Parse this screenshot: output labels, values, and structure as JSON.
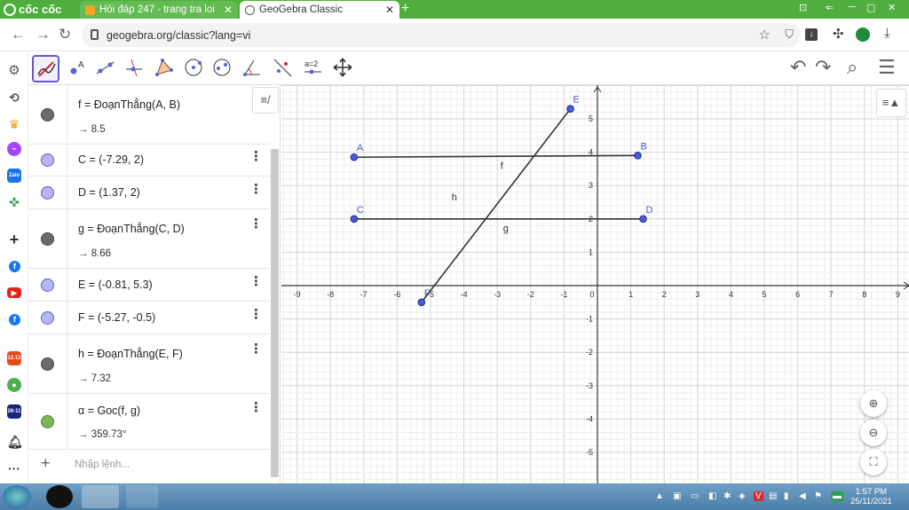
{
  "browser": {
    "brand": "cốc cốc",
    "tabs": [
      {
        "title": "Hỏi đáp 247 - trang tra loi",
        "active": false
      },
      {
        "title": "GeoGebra Classic",
        "active": true
      }
    ],
    "url": "geogebra.org/classic?lang=vi",
    "accent": "#4fae3e"
  },
  "algebra": {
    "rows": [
      {
        "def": "f = ĐoạnThẳng(A, B)",
        "value": "→ 8.5",
        "color": "gray"
      },
      {
        "def": "C = (-7.29, 2)",
        "color": "violet"
      },
      {
        "def": "D = (1.37, 2)",
        "color": "violet"
      },
      {
        "def": "g = ĐoạnThẳng(C, D)",
        "value": "→ 8.66",
        "color": "gray"
      },
      {
        "def": "E = (-0.81, 5.3)",
        "color": "violet"
      },
      {
        "def": "F = (-5.27, -0.5)",
        "color": "violet"
      },
      {
        "def": "h = ĐoạnThẳng(E, F)",
        "value": "→ 7.32",
        "color": "gray"
      },
      {
        "def": "α = Goc(f, g)",
        "value": "→ 359.73°",
        "color": "green"
      }
    ],
    "input_placeholder": "Nhập lệnh...",
    "style_button": "≡/"
  },
  "graphics": {
    "x_range": [
      -9,
      9
    ],
    "y_range": [
      -5,
      5
    ],
    "x_ticks": [
      "-9",
      "-8",
      "-7",
      "-6",
      "-5",
      "-4",
      "-3",
      "-2",
      "-1",
      "0",
      "1",
      "2",
      "3",
      "4",
      "5",
      "6",
      "7",
      "8",
      "9"
    ],
    "y_ticks": [
      "5",
      "4",
      "3",
      "2",
      "1",
      "-1",
      "-2",
      "-3",
      "-4",
      "-5"
    ],
    "points": [
      {
        "label": "A",
        "x": -7.29,
        "y": 3.85
      },
      {
        "label": "B",
        "x": 1.21,
        "y": 3.9
      },
      {
        "label": "C",
        "x": -7.29,
        "y": 2
      },
      {
        "label": "D",
        "x": 1.37,
        "y": 2
      },
      {
        "label": "E",
        "x": -0.81,
        "y": 5.3
      },
      {
        "label": "F",
        "x": -5.27,
        "y": -0.5
      }
    ],
    "segments": [
      {
        "label": "f",
        "from": "A",
        "to": "B"
      },
      {
        "label": "g",
        "from": "C",
        "to": "D"
      },
      {
        "label": "h",
        "from": "E",
        "to": "F"
      }
    ],
    "point_color": "#4a5bd9",
    "segment_color": "#333333"
  },
  "taskbar": {
    "time": "1:57 PM",
    "date": "25/11/2021"
  }
}
